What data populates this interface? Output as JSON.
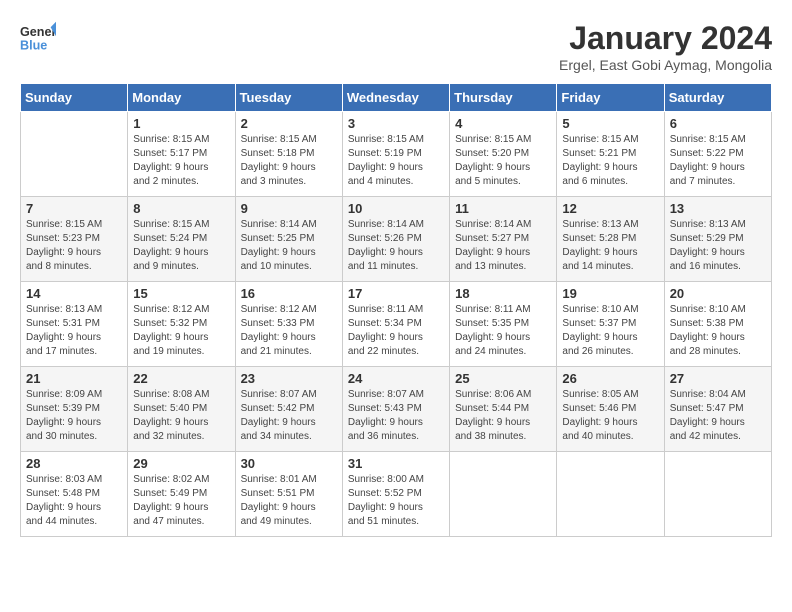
{
  "header": {
    "logo_general": "General",
    "logo_blue": "Blue",
    "month_title": "January 2024",
    "location": "Ergel, East Gobi Aymag, Mongolia"
  },
  "calendar": {
    "days_of_week": [
      "Sunday",
      "Monday",
      "Tuesday",
      "Wednesday",
      "Thursday",
      "Friday",
      "Saturday"
    ],
    "weeks": [
      [
        {
          "day": "",
          "info": ""
        },
        {
          "day": "1",
          "info": "Sunrise: 8:15 AM\nSunset: 5:17 PM\nDaylight: 9 hours\nand 2 minutes."
        },
        {
          "day": "2",
          "info": "Sunrise: 8:15 AM\nSunset: 5:18 PM\nDaylight: 9 hours\nand 3 minutes."
        },
        {
          "day": "3",
          "info": "Sunrise: 8:15 AM\nSunset: 5:19 PM\nDaylight: 9 hours\nand 4 minutes."
        },
        {
          "day": "4",
          "info": "Sunrise: 8:15 AM\nSunset: 5:20 PM\nDaylight: 9 hours\nand 5 minutes."
        },
        {
          "day": "5",
          "info": "Sunrise: 8:15 AM\nSunset: 5:21 PM\nDaylight: 9 hours\nand 6 minutes."
        },
        {
          "day": "6",
          "info": "Sunrise: 8:15 AM\nSunset: 5:22 PM\nDaylight: 9 hours\nand 7 minutes."
        }
      ],
      [
        {
          "day": "7",
          "info": "Sunrise: 8:15 AM\nSunset: 5:23 PM\nDaylight: 9 hours\nand 8 minutes."
        },
        {
          "day": "8",
          "info": "Sunrise: 8:15 AM\nSunset: 5:24 PM\nDaylight: 9 hours\nand 9 minutes."
        },
        {
          "day": "9",
          "info": "Sunrise: 8:14 AM\nSunset: 5:25 PM\nDaylight: 9 hours\nand 10 minutes."
        },
        {
          "day": "10",
          "info": "Sunrise: 8:14 AM\nSunset: 5:26 PM\nDaylight: 9 hours\nand 11 minutes."
        },
        {
          "day": "11",
          "info": "Sunrise: 8:14 AM\nSunset: 5:27 PM\nDaylight: 9 hours\nand 13 minutes."
        },
        {
          "day": "12",
          "info": "Sunrise: 8:13 AM\nSunset: 5:28 PM\nDaylight: 9 hours\nand 14 minutes."
        },
        {
          "day": "13",
          "info": "Sunrise: 8:13 AM\nSunset: 5:29 PM\nDaylight: 9 hours\nand 16 minutes."
        }
      ],
      [
        {
          "day": "14",
          "info": "Sunrise: 8:13 AM\nSunset: 5:31 PM\nDaylight: 9 hours\nand 17 minutes."
        },
        {
          "day": "15",
          "info": "Sunrise: 8:12 AM\nSunset: 5:32 PM\nDaylight: 9 hours\nand 19 minutes."
        },
        {
          "day": "16",
          "info": "Sunrise: 8:12 AM\nSunset: 5:33 PM\nDaylight: 9 hours\nand 21 minutes."
        },
        {
          "day": "17",
          "info": "Sunrise: 8:11 AM\nSunset: 5:34 PM\nDaylight: 9 hours\nand 22 minutes."
        },
        {
          "day": "18",
          "info": "Sunrise: 8:11 AM\nSunset: 5:35 PM\nDaylight: 9 hours\nand 24 minutes."
        },
        {
          "day": "19",
          "info": "Sunrise: 8:10 AM\nSunset: 5:37 PM\nDaylight: 9 hours\nand 26 minutes."
        },
        {
          "day": "20",
          "info": "Sunrise: 8:10 AM\nSunset: 5:38 PM\nDaylight: 9 hours\nand 28 minutes."
        }
      ],
      [
        {
          "day": "21",
          "info": "Sunrise: 8:09 AM\nSunset: 5:39 PM\nDaylight: 9 hours\nand 30 minutes."
        },
        {
          "day": "22",
          "info": "Sunrise: 8:08 AM\nSunset: 5:40 PM\nDaylight: 9 hours\nand 32 minutes."
        },
        {
          "day": "23",
          "info": "Sunrise: 8:07 AM\nSunset: 5:42 PM\nDaylight: 9 hours\nand 34 minutes."
        },
        {
          "day": "24",
          "info": "Sunrise: 8:07 AM\nSunset: 5:43 PM\nDaylight: 9 hours\nand 36 minutes."
        },
        {
          "day": "25",
          "info": "Sunrise: 8:06 AM\nSunset: 5:44 PM\nDaylight: 9 hours\nand 38 minutes."
        },
        {
          "day": "26",
          "info": "Sunrise: 8:05 AM\nSunset: 5:46 PM\nDaylight: 9 hours\nand 40 minutes."
        },
        {
          "day": "27",
          "info": "Sunrise: 8:04 AM\nSunset: 5:47 PM\nDaylight: 9 hours\nand 42 minutes."
        }
      ],
      [
        {
          "day": "28",
          "info": "Sunrise: 8:03 AM\nSunset: 5:48 PM\nDaylight: 9 hours\nand 44 minutes."
        },
        {
          "day": "29",
          "info": "Sunrise: 8:02 AM\nSunset: 5:49 PM\nDaylight: 9 hours\nand 47 minutes."
        },
        {
          "day": "30",
          "info": "Sunrise: 8:01 AM\nSunset: 5:51 PM\nDaylight: 9 hours\nand 49 minutes."
        },
        {
          "day": "31",
          "info": "Sunrise: 8:00 AM\nSunset: 5:52 PM\nDaylight: 9 hours\nand 51 minutes."
        },
        {
          "day": "",
          "info": ""
        },
        {
          "day": "",
          "info": ""
        },
        {
          "day": "",
          "info": ""
        }
      ]
    ]
  }
}
